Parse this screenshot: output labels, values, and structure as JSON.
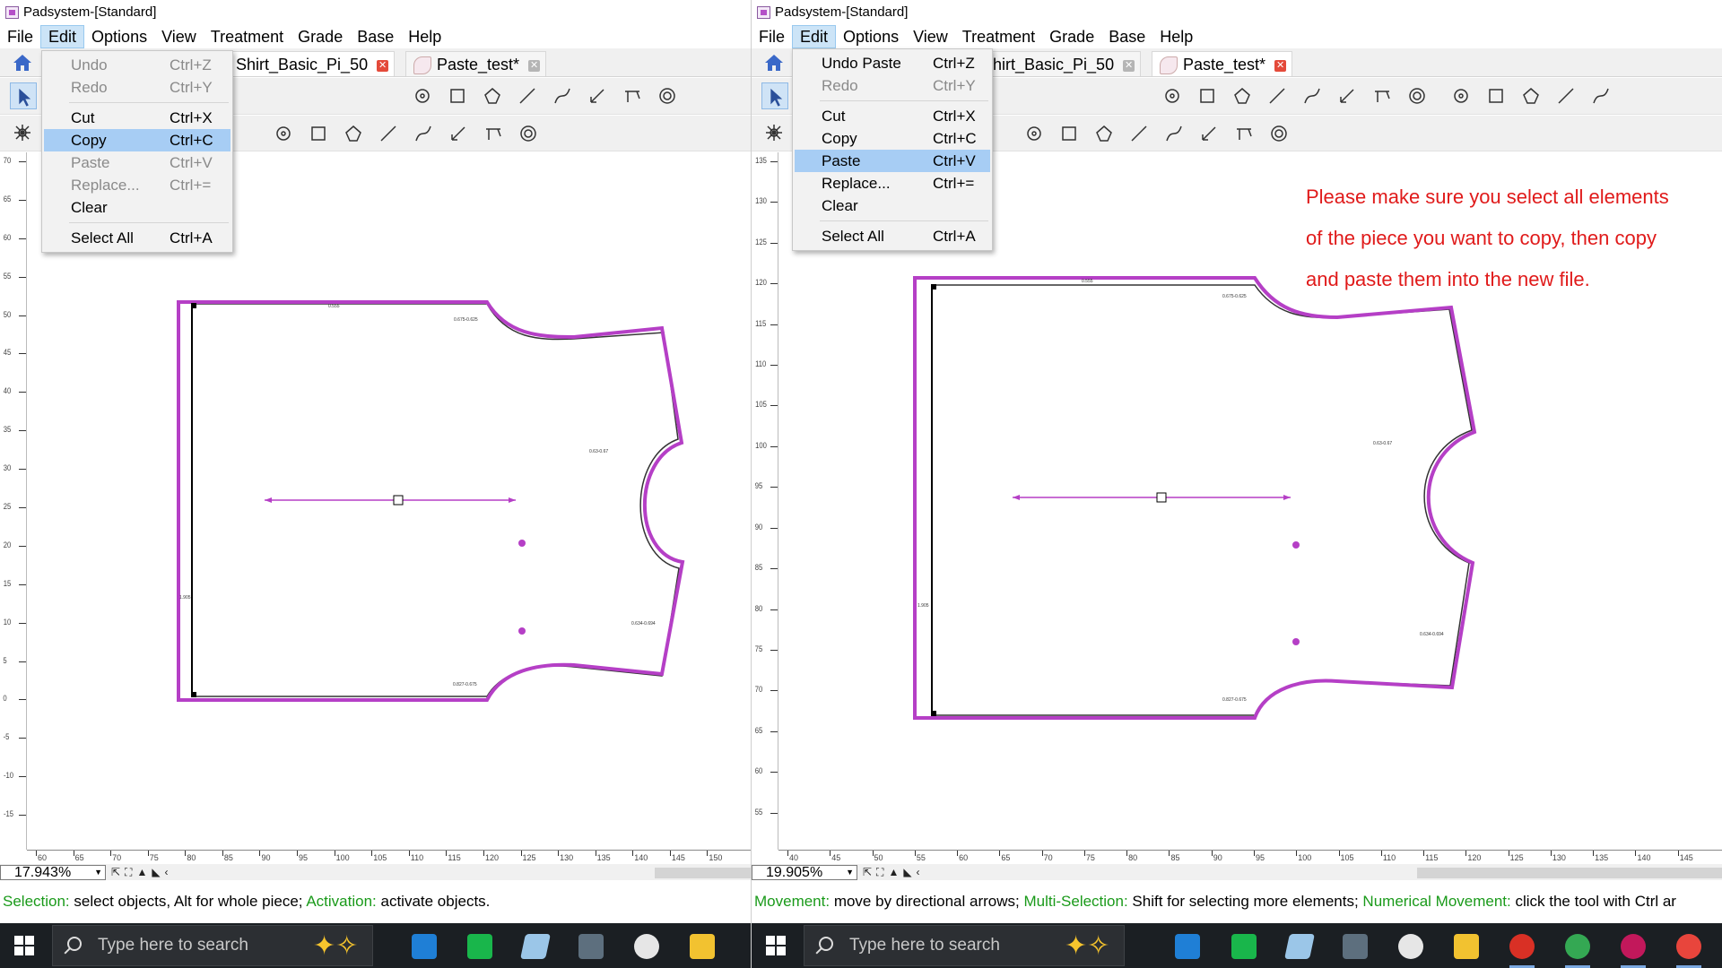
{
  "left_window": {
    "title": "Padsystem-[Standard]",
    "menu": [
      "File",
      "Edit",
      "Options",
      "View",
      "Treatment",
      "Grade",
      "Base",
      "Help"
    ],
    "active_menu": "Edit",
    "tabs": [
      {
        "label": "Shirt_Basic_Pi_50",
        "active": true
      },
      {
        "label": "Paste_test*",
        "active": false
      }
    ],
    "edit_menu": [
      {
        "label": "Undo",
        "shortcut": "Ctrl+Z",
        "disabled": true
      },
      {
        "label": "Redo",
        "shortcut": "Ctrl+Y",
        "disabled": true
      },
      {
        "label": "Cut",
        "shortcut": "Ctrl+X",
        "disabled": false
      },
      {
        "label": "Copy",
        "shortcut": "Ctrl+C",
        "disabled": false,
        "highlighted": true
      },
      {
        "label": "Paste",
        "shortcut": "Ctrl+V",
        "disabled": true
      },
      {
        "label": "Replace...",
        "shortcut": "Ctrl+=",
        "disabled": true
      },
      {
        "label": "Clear",
        "shortcut": "",
        "disabled": false
      },
      {
        "label": "Select All",
        "shortcut": "Ctrl+A",
        "disabled": false
      }
    ],
    "zoom": "17.943%",
    "vruler_labels": [
      "70",
      "65",
      "60",
      "55",
      "50",
      "45",
      "40",
      "35",
      "30",
      "25",
      "20",
      "15",
      "10",
      "5",
      "0",
      "-5",
      "-10",
      "-15"
    ],
    "hruler_labels": [
      "60",
      "65",
      "70",
      "75",
      "80",
      "85",
      "90",
      "95",
      "100",
      "105",
      "110",
      "115",
      "120",
      "125",
      "130",
      "135",
      "140",
      "145",
      "150"
    ],
    "piece_labels": [
      "0.555",
      "0.675-0.625",
      "0.63-0.67",
      "0.634-0.694",
      "0.827-0.675",
      "1.905"
    ],
    "status": [
      {
        "text": "Selection:",
        "highlight": true
      },
      {
        "text": " select objects, Alt for whole piece; ",
        "highlight": false
      },
      {
        "text": "Activation:",
        "highlight": true
      },
      {
        "text": " activate objects.",
        "highlight": false
      }
    ]
  },
  "right_window": {
    "title": "Padsystem-[Standard]",
    "menu": [
      "File",
      "Edit",
      "Options",
      "View",
      "Treatment",
      "Grade",
      "Base",
      "Help"
    ],
    "active_menu": "Edit",
    "tabs": [
      {
        "label": "hirt_Basic_Pi_50",
        "active": false
      },
      {
        "label": "Paste_test*",
        "active": true
      }
    ],
    "edit_menu": [
      {
        "label": "Undo Paste",
        "shortcut": "Ctrl+Z",
        "disabled": false
      },
      {
        "label": "Redo",
        "shortcut": "Ctrl+Y",
        "disabled": true
      },
      {
        "label": "Cut",
        "shortcut": "Ctrl+X",
        "disabled": false
      },
      {
        "label": "Copy",
        "shortcut": "Ctrl+C",
        "disabled": false
      },
      {
        "label": "Paste",
        "shortcut": "Ctrl+V",
        "disabled": false,
        "highlighted": true
      },
      {
        "label": "Replace...",
        "shortcut": "Ctrl+=",
        "disabled": false
      },
      {
        "label": "Clear",
        "shortcut": "",
        "disabled": false
      },
      {
        "label": "Select All",
        "shortcut": "Ctrl+A",
        "disabled": false
      }
    ],
    "note_lines": [
      "Please make sure you select all elements",
      "of the piece you want to copy, then copy",
      "and paste them into the new file."
    ],
    "zoom": "19.905%",
    "vruler_labels": [
      "135",
      "130",
      "125",
      "120",
      "115",
      "110",
      "105",
      "100",
      "95",
      "90",
      "85",
      "80",
      "75",
      "70",
      "65",
      "60",
      "55"
    ],
    "hruler_labels": [
      "40",
      "45",
      "50",
      "55",
      "60",
      "65",
      "70",
      "75",
      "80",
      "85",
      "90",
      "95",
      "100",
      "105",
      "110",
      "115",
      "120",
      "125",
      "130",
      "135",
      "140",
      "145"
    ],
    "piece_labels": [
      "0.555",
      "0.675-0.625",
      "0.63-0.67",
      "0.634-0.694",
      "0.827-0.675",
      "1.905"
    ],
    "status": [
      {
        "text": "Movement:",
        "highlight": true
      },
      {
        "text": " move by directional arrows; ",
        "highlight": false
      },
      {
        "text": "Multi-Selection:",
        "highlight": true
      },
      {
        "text": " Shift for selecting more elements; ",
        "highlight": false
      },
      {
        "text": "Numerical Movement:",
        "highlight": true
      },
      {
        "text": " click the tool with Ctrl ar",
        "highlight": false
      }
    ]
  },
  "taskbar": {
    "search_placeholder": "Type here to search"
  },
  "colors": {
    "piece_outline": "#b53fc6",
    "menu_highlight": "#a7cdf4",
    "note_text": "#e01a1a",
    "status_keyword": "#1a9a1a"
  }
}
